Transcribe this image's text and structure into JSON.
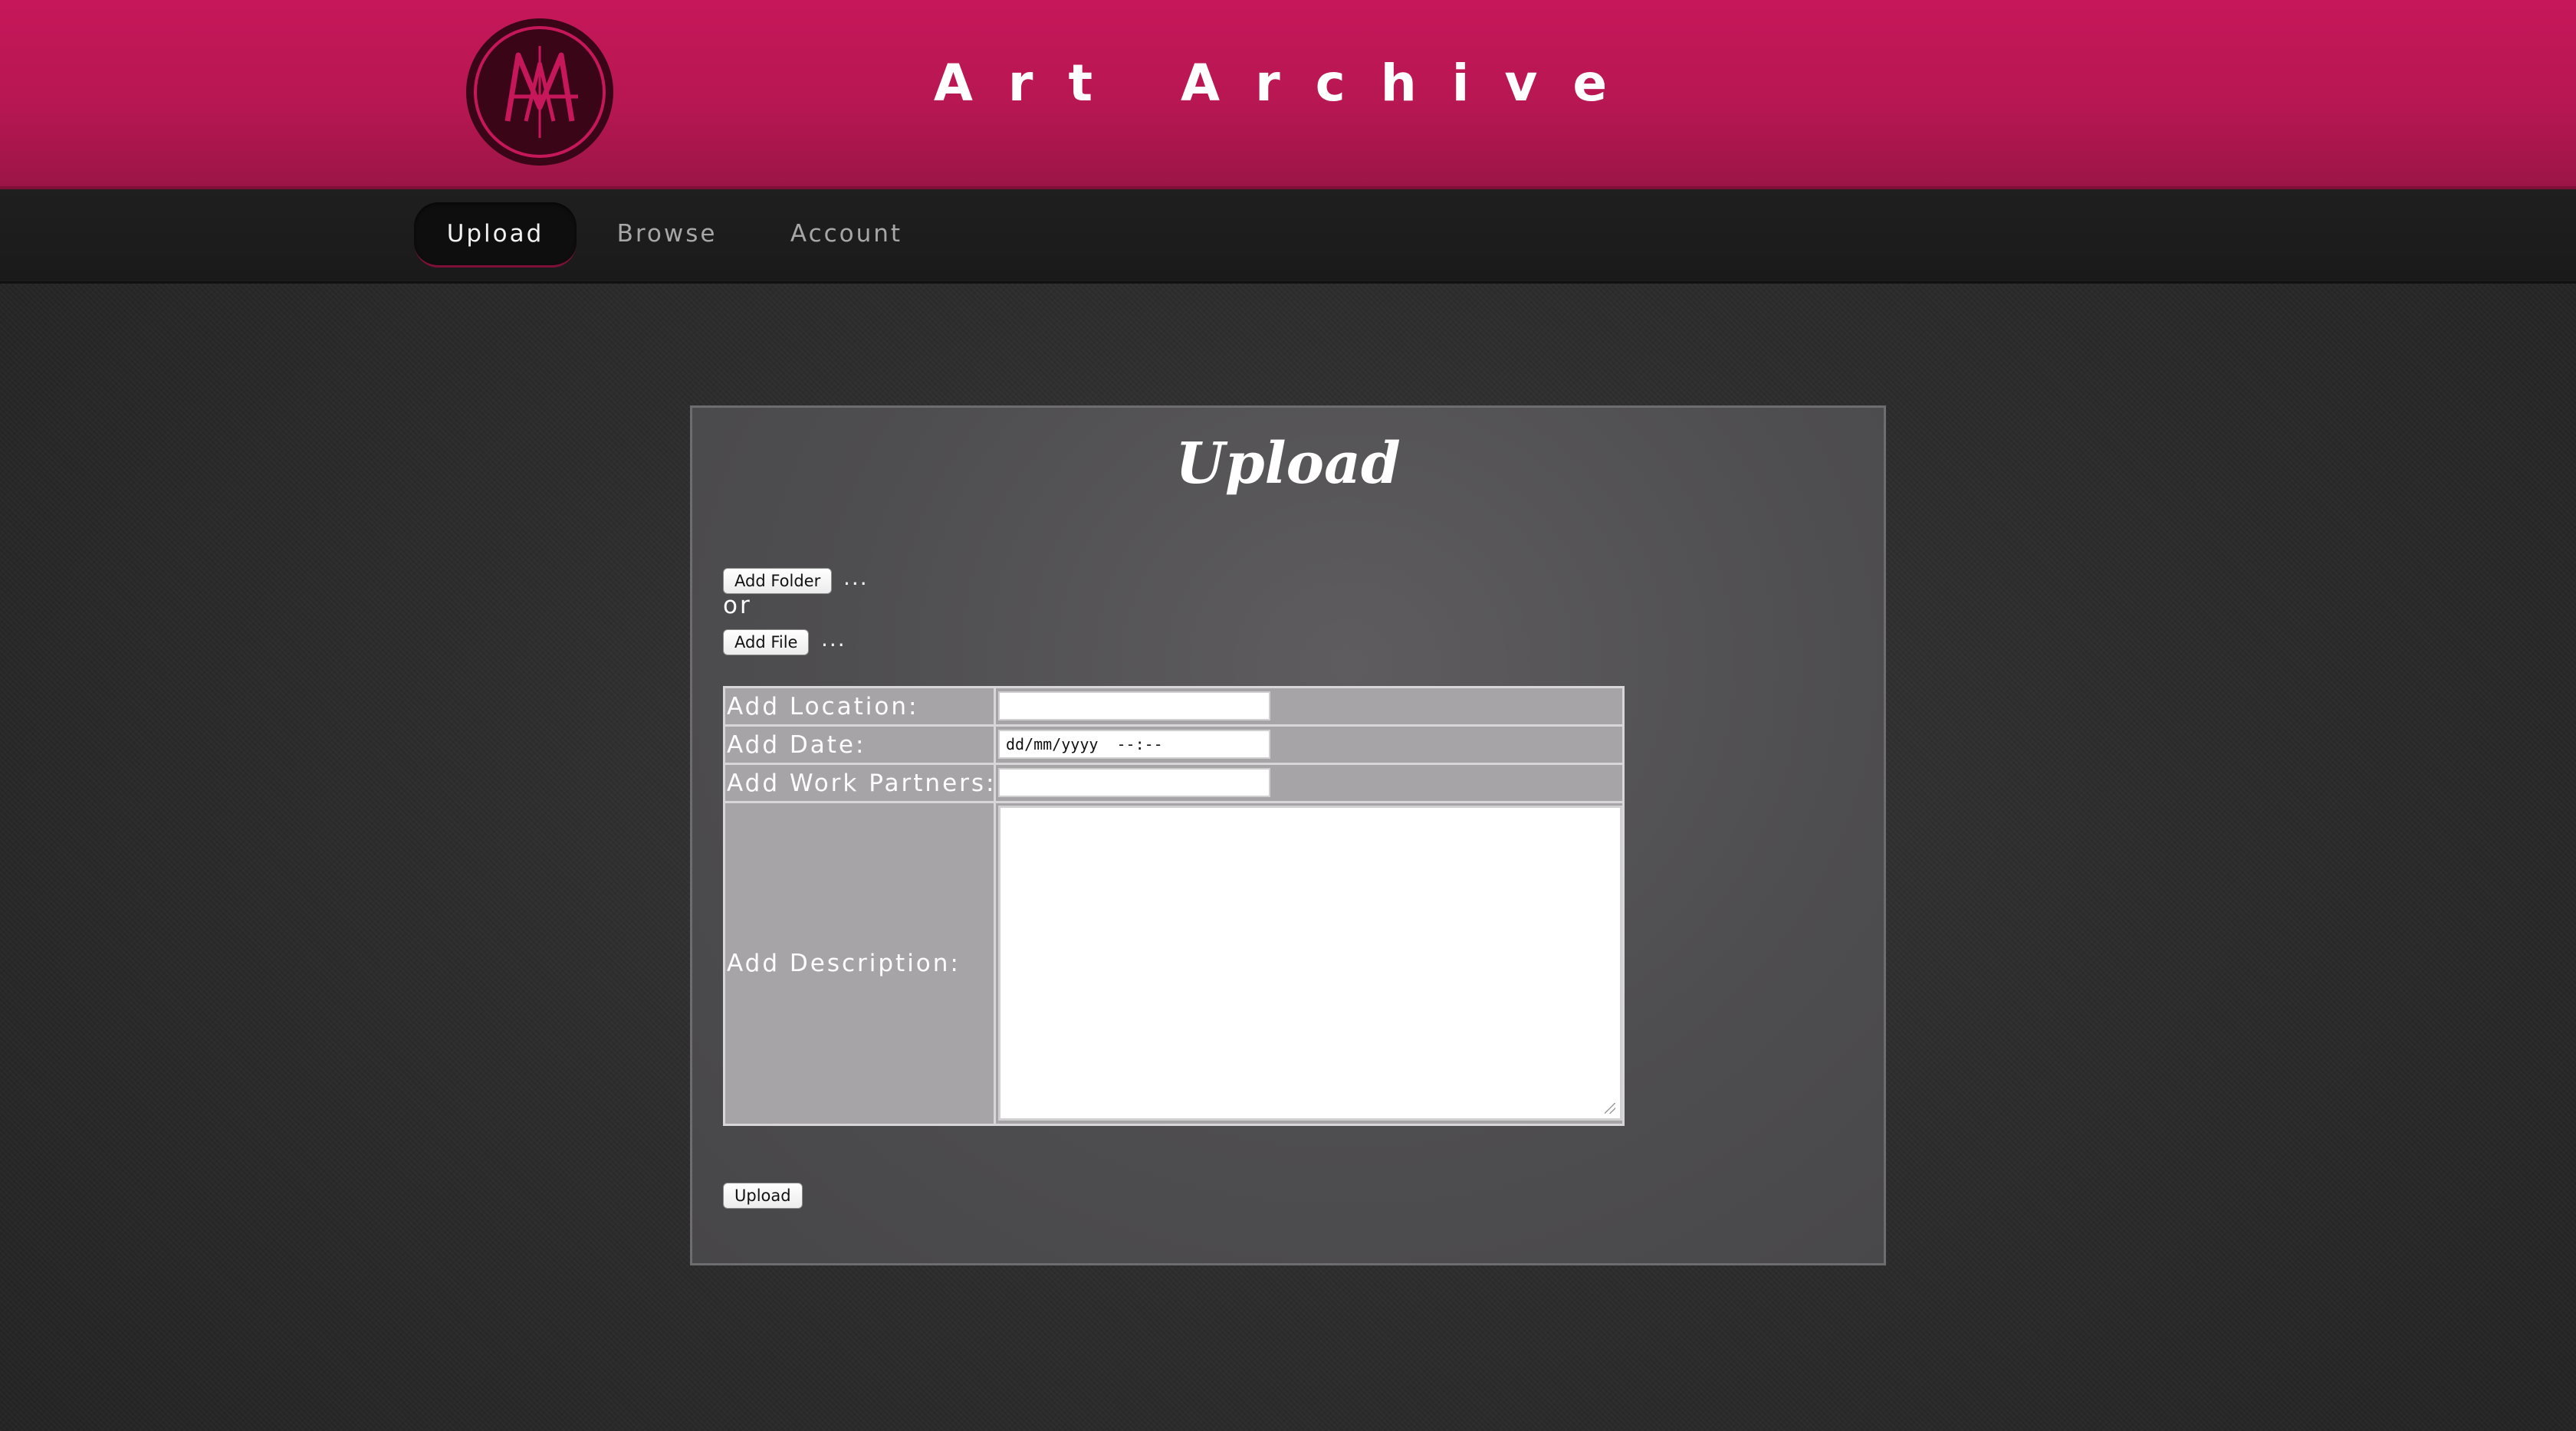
{
  "header": {
    "site_title": "Art Archive",
    "logo_icon": "art-archive-logo-icon"
  },
  "nav": {
    "items": [
      {
        "label": "Upload",
        "active": true
      },
      {
        "label": "Browse",
        "active": false
      },
      {
        "label": "Account",
        "active": false
      }
    ]
  },
  "panel": {
    "title": "Upload",
    "add_folder_label": "Add Folder",
    "add_folder_status": "...",
    "or_text": "or",
    "add_file_label": "Add File",
    "add_file_status": "...",
    "form": {
      "location_label": "Add Location:",
      "location_value": "",
      "date_label": "Add Date:",
      "date_placeholder": "dd/mm/yyyy  --:--",
      "partners_label": "Add Work Partners:",
      "partners_value": "",
      "description_label": "Add Description:",
      "description_value": ""
    },
    "upload_button_label": "Upload"
  },
  "colors": {
    "header_pink": "#c6175a",
    "nav_dark": "#1c1c1c",
    "panel_gray": "#555456",
    "form_gray": "#a7a4a7"
  }
}
